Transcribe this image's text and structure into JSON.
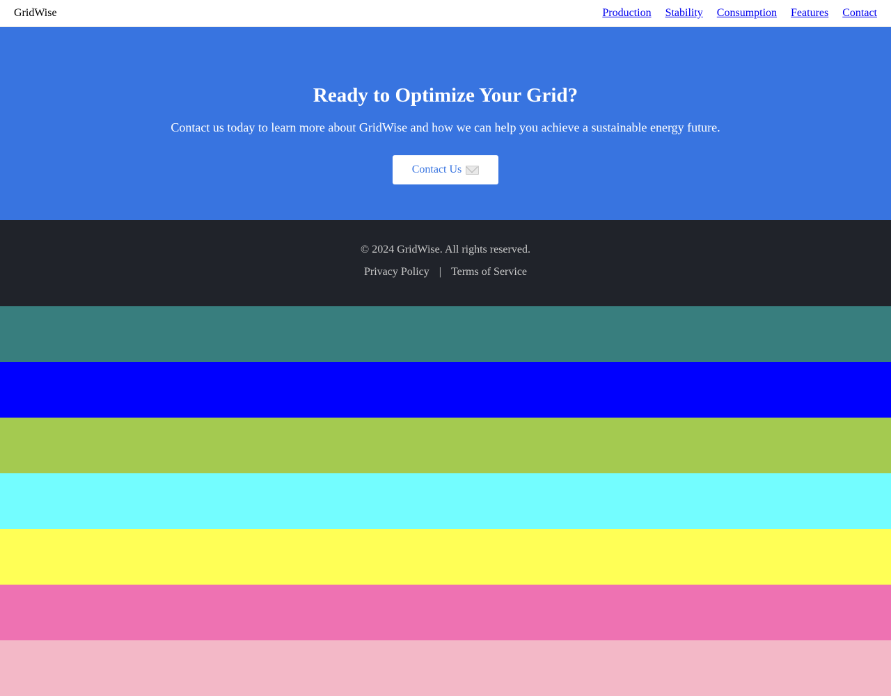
{
  "nav": {
    "brand": "GridWise",
    "links": [
      "Production",
      "Stability",
      "Consumption",
      "Features",
      "Contact"
    ]
  },
  "cta": {
    "heading": "Ready to Optimize Your Grid?",
    "text": "Contact us today to learn more about GridWise and how we can help you achieve a sustainable energy future.",
    "button_label": "Contact Us",
    "button_icon": "envelope-icon"
  },
  "footer": {
    "copyright": "© 2024 GridWise. All rights reserved.",
    "privacy": "Privacy Policy",
    "separator": "|",
    "terms": "Terms of Service"
  },
  "colors": {
    "accent": "#3874e0",
    "footer_bg": "#20232a",
    "swatches": [
      "#387e7e",
      "#0000ff",
      "#a4ca50",
      "#73fdff",
      "#ffff56",
      "#ee72b2",
      "#f3b8c7"
    ]
  }
}
